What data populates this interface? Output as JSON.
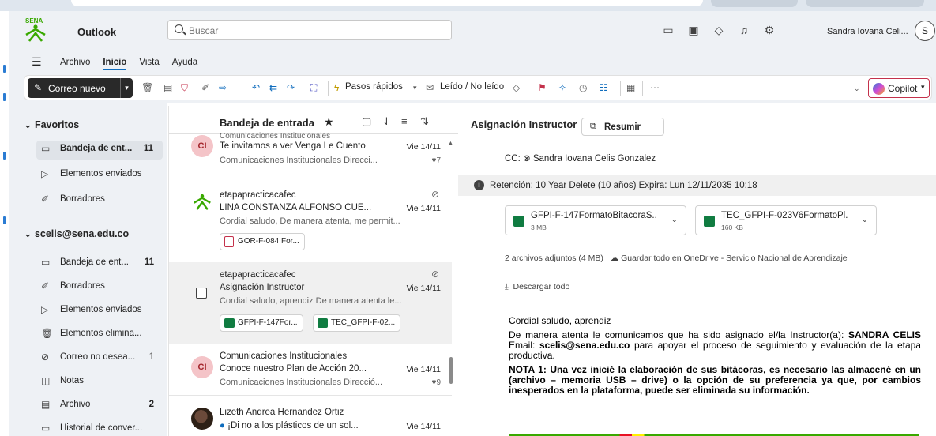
{
  "app": {
    "title": "Outlook",
    "logo_text": "SENA",
    "user_name": "Sandra Iovana Celi...",
    "user_initial": "S"
  },
  "search": {
    "placeholder": "Buscar"
  },
  "menu": {
    "items": [
      "Archivo",
      "Inicio",
      "Vista",
      "Ayuda"
    ],
    "active": "Inicio"
  },
  "ribbon": {
    "new_mail": "Correo nuevo",
    "quick_steps": "Pasos rápidos",
    "read_unread": "Leído / No leído",
    "copilot": "Copilot"
  },
  "folders": {
    "favorites_label": "Favoritos",
    "account_label": "scelis@sena.edu.co",
    "favorites": [
      {
        "label": "Bandeja de ent...",
        "count": "11",
        "icon": "inbox-icon"
      },
      {
        "label": "Elementos enviados",
        "count": "",
        "icon": "send-icon"
      },
      {
        "label": "Borradores",
        "count": "",
        "icon": "draft-icon"
      }
    ],
    "account": [
      {
        "label": "Bandeja de ent...",
        "count": "11",
        "icon": "inbox-icon"
      },
      {
        "label": "Borradores",
        "count": "",
        "icon": "draft-icon"
      },
      {
        "label": "Elementos enviados",
        "count": "",
        "icon": "send-icon"
      },
      {
        "label": "Elementos elimina...",
        "count": "",
        "icon": "trash-icon"
      },
      {
        "label": "Correo no desea...",
        "count": "1",
        "icon": "junk-icon"
      },
      {
        "label": "Notas",
        "count": "",
        "icon": "note-icon"
      },
      {
        "label": "Archivo",
        "count": "2",
        "icon": "archive-icon"
      },
      {
        "label": "Historial de conver...",
        "count": "",
        "icon": "history-icon"
      }
    ]
  },
  "list": {
    "title": "Bandeja de entrada",
    "messages": [
      {
        "from": "Comunicaciones Institucionales",
        "subject": "Te invitamos a ver Venga Le Cuento",
        "date": "Vie 14/11",
        "preview": "Comunicaciones Institucionales Direcci...",
        "reaction": "7",
        "avatar": "CI"
      },
      {
        "from": "etapapracticacafec",
        "subject": "LINA CONSTANZA ALFONSO CUE...",
        "date": "Vie 14/11",
        "preview": "Cordial saludo, De manera atenta, me permit...",
        "attachments": [
          "GOR-F-084 For..."
        ]
      },
      {
        "from": "etapapracticacafec",
        "subject": "Asignación Instructor",
        "date": "Vie 14/11",
        "preview": "Cordial saludo, aprendiz De manera atenta le...",
        "attachments": [
          "GFPI-F-147For...",
          "TEC_GFPI-F-02..."
        ]
      },
      {
        "from": "Comunicaciones Institucionales",
        "subject": "Conoce nuestro Plan de Acción 20...",
        "date": "Vie 14/11",
        "preview": "Comunicaciones Institucionales Direcció...",
        "reaction": "9",
        "avatar": "CI"
      },
      {
        "from": "Lizeth Andrea Hernandez Ortiz",
        "subject": "¡Di no a los plásticos de un sol...",
        "date": "Vie 14/11",
        "preview": ""
      }
    ]
  },
  "reading": {
    "subject": "Asignación Instructor",
    "summarize": "Resumir",
    "cc": "CC: ⊗ Sandra Iovana Celis Gonzalez",
    "retention": "Retención: 10 Year Delete (10 años) Expira: Lun 12/11/2035 10:18",
    "attachments": [
      {
        "name": "GFPI-F-147FormatoBitacoraS...",
        "size": "3 MB"
      },
      {
        "name": "TEC_GFPI-F-023V6FormatoPl...",
        "size": "160 KB"
      }
    ],
    "attach_info": "2 archivos adjuntos (4 MB)",
    "save_onedrive": "Guardar todo en OneDrive - Servicio Nacional de Aprendizaje",
    "download_all": "Descargar todo",
    "greeting": "Cordial saludo, aprendiz",
    "p1_a": "De manera atenta le comunicamos que ha sido asignado el/la Instructor(a): ",
    "p1_name": "SANDRA CELIS",
    "p1_b": " Email: ",
    "p1_email": "scelis@sena.edu.co",
    "p1_c": " para apoyar el proceso de seguimiento y evaluación de la etapa productiva.",
    "note1": "NOTA 1: Una vez inicié la elaboración de sus bitácoras, es necesario las almacené en un (archivo – memoria USB – drive) o la opción de su preferencia ya que, por cambios inesperados en la plataforma, puede ser eliminada su información."
  }
}
